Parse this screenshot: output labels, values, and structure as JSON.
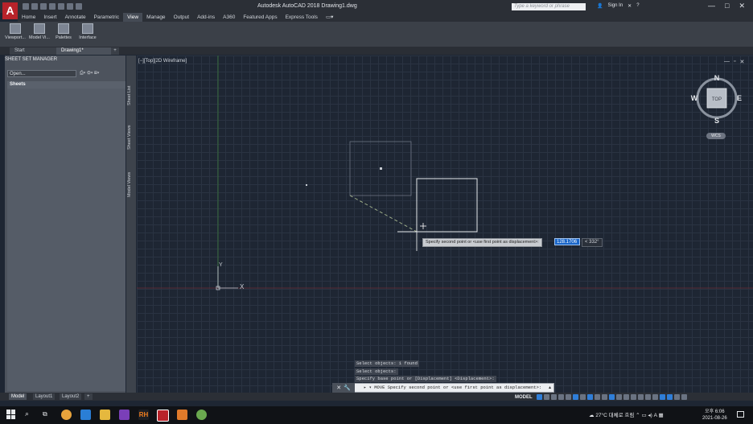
{
  "app": {
    "logo": "A",
    "title": "Autodesk AutoCAD 2018    Drawing1.dwg",
    "search_placeholder": "Type a keyword or phrase",
    "sign_in": "Sign In",
    "window_buttons": [
      "—",
      "□",
      "✕"
    ]
  },
  "ribbon": {
    "tabs": [
      "Home",
      "Insert",
      "Annotate",
      "Parametric",
      "View",
      "Manage",
      "Output",
      "Add-ins",
      "A360",
      "Featured Apps",
      "Express Tools"
    ],
    "active_tab": "View",
    "panels": [
      {
        "label": "Viewport...",
        "icon": "viewport-icon"
      },
      {
        "label": "Model Vi...",
        "icon": "model-views-icon"
      },
      {
        "label": "Palettes",
        "icon": "palettes-icon"
      },
      {
        "label": "Interface",
        "icon": "interface-icon"
      }
    ]
  },
  "doc_tabs": {
    "start": "Start",
    "drawing": "Drawing1*",
    "add": "+"
  },
  "sheet_set_manager": {
    "title": "SHEET SET MANAGER",
    "select_value": "Open...",
    "sheets_header": "Sheets",
    "side_tabs": [
      "Sheet List",
      "Sheet Views",
      "Model Views"
    ]
  },
  "viewport": {
    "label": "[−][Top][2D Wireframe]",
    "controls": [
      "—",
      "▫",
      "✕"
    ],
    "compass": {
      "n": "N",
      "s": "S",
      "e": "E",
      "w": "W",
      "center": "TOP"
    },
    "ucs_label": "WCS",
    "axis_y": "Y",
    "axis_x": "X"
  },
  "dynamic_input": {
    "prompt": "Specify second point or <use first point as displacement>:",
    "value": "128.1706",
    "angle": "< 332°"
  },
  "command_history": [
    "Select objects: 1 found",
    "Select objects:",
    "Specify base point or [Displacement] <Displacement>:"
  ],
  "command_line": {
    "prompt": "▸ ▾ MOVE Specify second point or <use first point as displacement>:"
  },
  "layout_tabs": [
    "Model",
    "Layout1",
    "Layout2",
    "+"
  ],
  "status": {
    "model": "MODEL"
  },
  "taskbar": {
    "weather": "27°C  대체로 흐림",
    "lang": "A",
    "time": "오후 6:06",
    "date": "2021-08-26"
  },
  "colors": {
    "accent": "#2f7ed8",
    "canvas": "#1e2633",
    "autocad_red": "#b8232a"
  }
}
